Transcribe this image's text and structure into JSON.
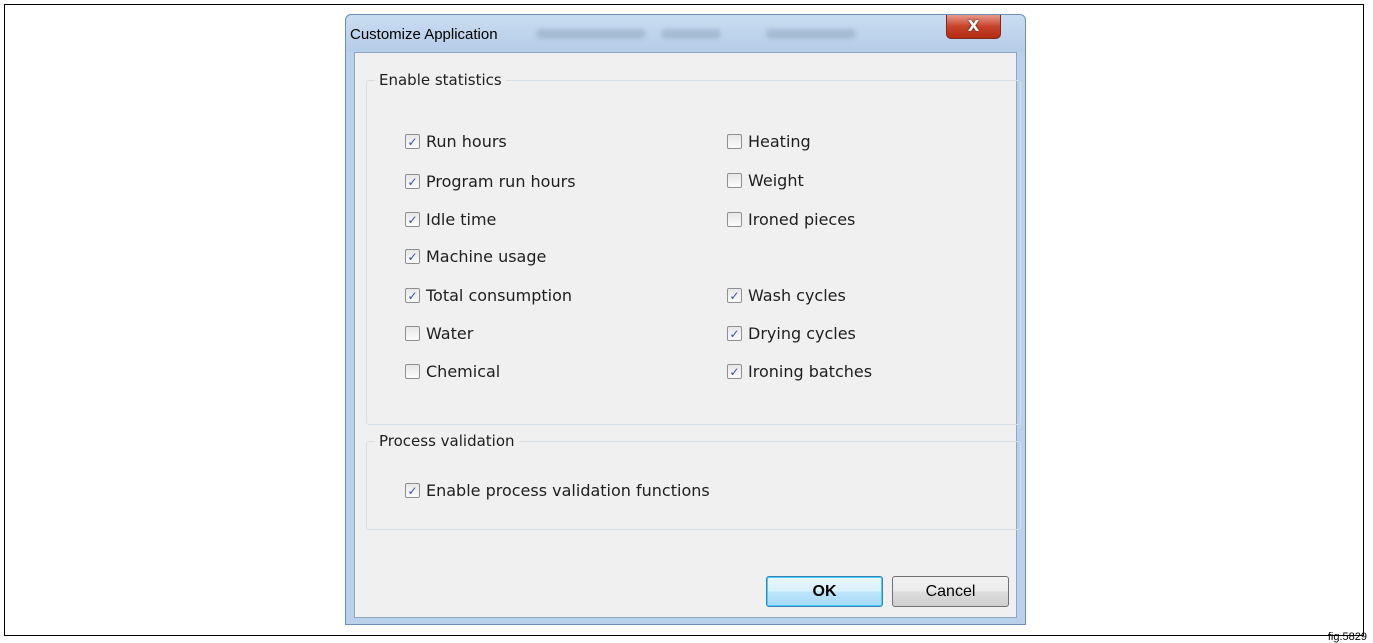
{
  "dialog": {
    "title": "Customize Application",
    "close_label": "X"
  },
  "statistics": {
    "legend": "Enable statistics",
    "left": [
      {
        "label": "Run hours",
        "checked": true
      },
      {
        "label": "Program run hours",
        "checked": true
      },
      {
        "label": "Idle time",
        "checked": true
      },
      {
        "label": "Machine usage",
        "checked": true
      },
      {
        "label": "Total consumption",
        "checked": true
      },
      {
        "label": "Water",
        "checked": false
      },
      {
        "label": "Chemical",
        "checked": false
      }
    ],
    "right": [
      {
        "label": "Heating",
        "checked": false
      },
      {
        "label": "Weight",
        "checked": false
      },
      {
        "label": "Ironed pieces",
        "checked": false
      },
      {
        "label": "Wash cycles",
        "checked": true
      },
      {
        "label": "Drying cycles",
        "checked": true
      },
      {
        "label": "Ironing batches",
        "checked": true
      }
    ]
  },
  "process_validation": {
    "legend": "Process validation",
    "option": {
      "label": "Enable process validation functions",
      "checked": true
    }
  },
  "buttons": {
    "ok": "OK",
    "cancel": "Cancel"
  },
  "figure_label": "fig.5829",
  "check_glyph": "✓"
}
